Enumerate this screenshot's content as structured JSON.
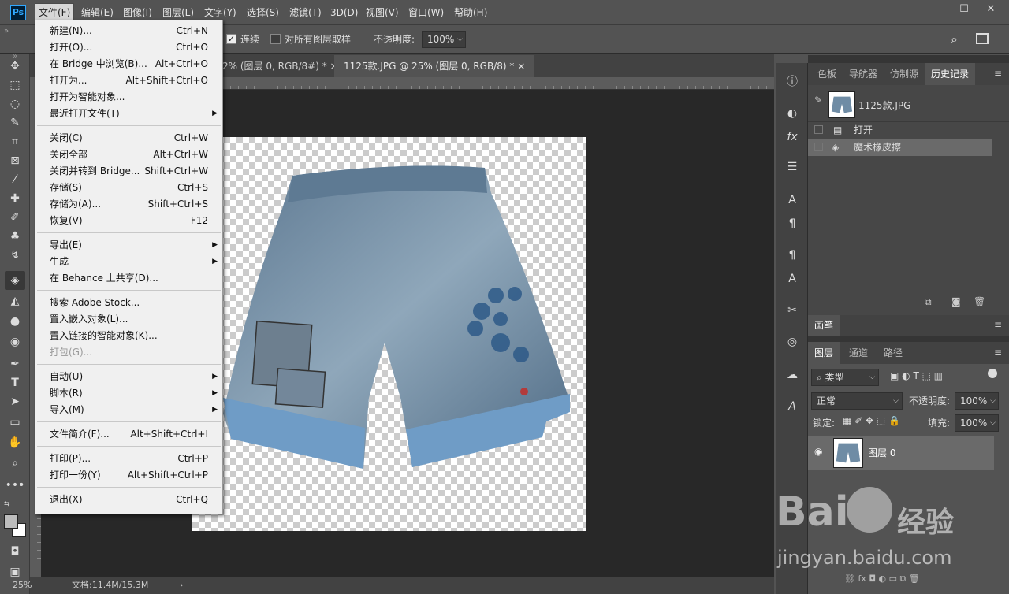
{
  "menubar": {
    "logo": "Ps",
    "items": [
      "文件(F)",
      "编辑(E)",
      "图像(I)",
      "图层(L)",
      "文字(Y)",
      "选择(S)",
      "滤镜(T)",
      "3D(D)",
      "视图(V)",
      "窗口(W)",
      "帮助(H)"
    ]
  },
  "window": {
    "minimize": "—",
    "maximize": "☐",
    "close": "✕"
  },
  "options": {
    "contiguous": "连续",
    "sample_all": "对所有图层取样",
    "opacity_label": "不透明度:",
    "opacity_value": "100%"
  },
  "tabs": [
    {
      "label": "2% (图层 0, RGB/8#) *",
      "close": "×"
    },
    {
      "label": "1125款.JPG @ 25% (图层 0, RGB/8) *",
      "close": "×"
    }
  ],
  "status": {
    "zoom": "25%",
    "doc": "文档:11.4M/15.3M"
  },
  "file_menu": [
    {
      "label": "新建(N)...",
      "shortcut": "Ctrl+N"
    },
    {
      "label": "打开(O)...",
      "shortcut": "Ctrl+O"
    },
    {
      "label": "在 Bridge 中浏览(B)...",
      "shortcut": "Alt+Ctrl+O"
    },
    {
      "label": "打开为...",
      "shortcut": "Alt+Shift+Ctrl+O"
    },
    {
      "label": "打开为智能对象...",
      "shortcut": ""
    },
    {
      "label": "最近打开文件(T)",
      "shortcut": "",
      "submenu": true
    },
    {
      "sep": true
    },
    {
      "label": "关闭(C)",
      "shortcut": "Ctrl+W"
    },
    {
      "label": "关闭全部",
      "shortcut": "Alt+Ctrl+W"
    },
    {
      "label": "关闭并转到 Bridge...",
      "shortcut": "Shift+Ctrl+W"
    },
    {
      "label": "存储(S)",
      "shortcut": "Ctrl+S"
    },
    {
      "label": "存储为(A)...",
      "shortcut": "Shift+Ctrl+S"
    },
    {
      "label": "恢复(V)",
      "shortcut": "F12"
    },
    {
      "sep": true
    },
    {
      "label": "导出(E)",
      "shortcut": "",
      "submenu": true
    },
    {
      "label": "生成",
      "shortcut": "",
      "submenu": true
    },
    {
      "label": "在 Behance 上共享(D)...",
      "shortcut": ""
    },
    {
      "sep": true
    },
    {
      "label": "搜索 Adobe Stock...",
      "shortcut": ""
    },
    {
      "label": "置入嵌入对象(L)...",
      "shortcut": ""
    },
    {
      "label": "置入链接的智能对象(K)...",
      "shortcut": ""
    },
    {
      "label": "打包(G)...",
      "shortcut": "",
      "disabled": true
    },
    {
      "sep": true
    },
    {
      "label": "自动(U)",
      "shortcut": "",
      "submenu": true
    },
    {
      "label": "脚本(R)",
      "shortcut": "",
      "submenu": true
    },
    {
      "label": "导入(M)",
      "shortcut": "",
      "submenu": true
    },
    {
      "sep": true
    },
    {
      "label": "文件简介(F)...",
      "shortcut": "Alt+Shift+Ctrl+I"
    },
    {
      "sep": true
    },
    {
      "label": "打印(P)...",
      "shortcut": "Ctrl+P"
    },
    {
      "label": "打印一份(Y)",
      "shortcut": "Alt+Shift+Ctrl+P"
    },
    {
      "sep": true
    },
    {
      "label": "退出(X)",
      "shortcut": "Ctrl+Q"
    }
  ],
  "history_panel": {
    "tabs": [
      "色板",
      "导航器",
      "仿制源",
      "历史记录"
    ],
    "snapshot": "1125款.JPG",
    "steps": [
      "打开",
      "魔术橡皮擦"
    ]
  },
  "brush_panel": {
    "title": "画笔"
  },
  "layers_panel": {
    "tabs": [
      "图层",
      "通道",
      "路径"
    ],
    "filter": "类型",
    "blend": "正常",
    "opacity_label": "不透明度:",
    "opacity": "100%",
    "lock_label": "锁定:",
    "fill_label": "填充:",
    "fill": "100%",
    "layer_name": "图层 0"
  },
  "watermark": {
    "brand": "Bai",
    "brand2": "经验",
    "url": "jingyan.baidu.com"
  },
  "colors": {
    "arrow": "#e8262a",
    "accent": "#31a8ff"
  }
}
